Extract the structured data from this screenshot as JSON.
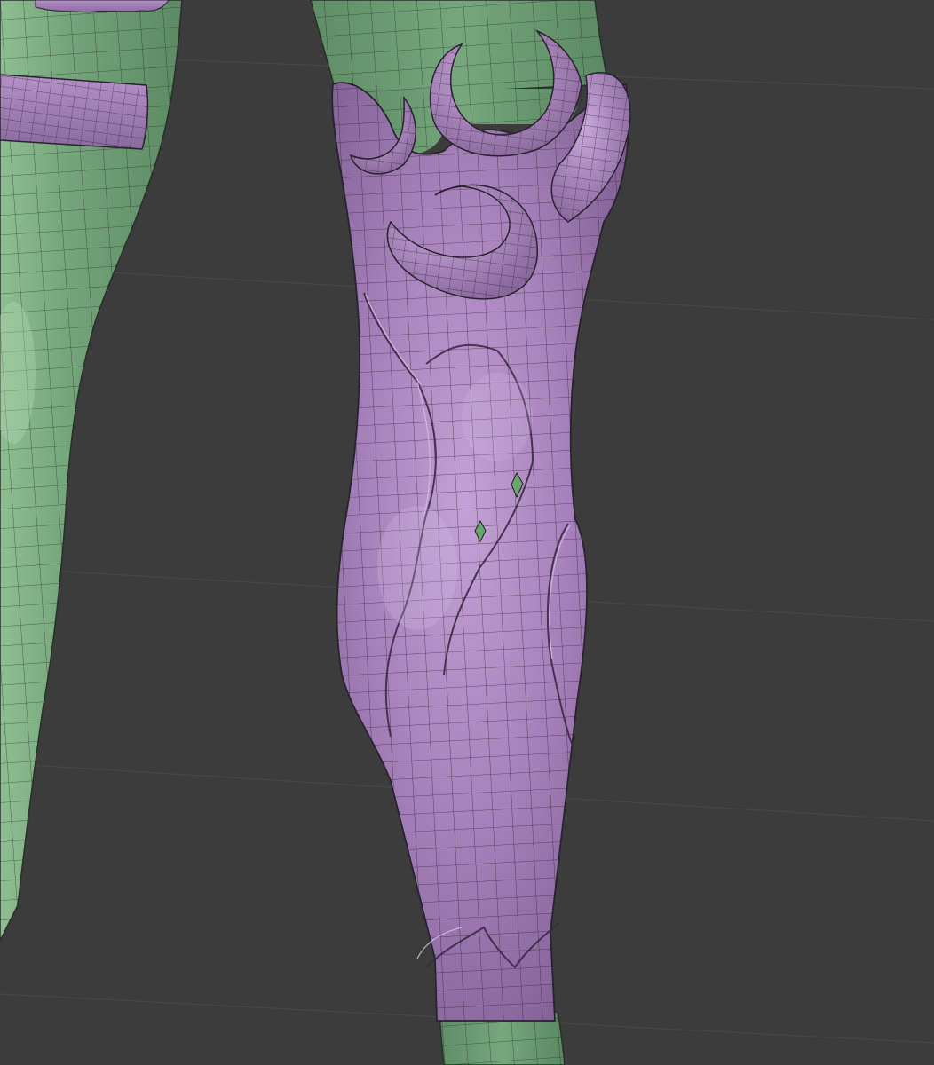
{
  "viewport": {
    "background_color": "#3c3c3c",
    "grid_line_color": "#464646"
  },
  "materials": {
    "skin_color": "#6f9f76",
    "skin_highlight": "#8fbe92",
    "armor_color": "#a07cb4",
    "armor_highlight": "#c4a1d6",
    "armor_shadow": "#6e4f80",
    "wire_color": "#1e1e22"
  },
  "objects": [
    {
      "name": "left-leg-mesh",
      "material": "skin"
    },
    {
      "name": "left-thigh-band",
      "material": "armor"
    },
    {
      "name": "right-thigh-mesh",
      "material": "skin"
    },
    {
      "name": "right-greave-mesh",
      "material": "armor"
    },
    {
      "name": "right-ankle-mesh",
      "material": "skin"
    }
  ]
}
